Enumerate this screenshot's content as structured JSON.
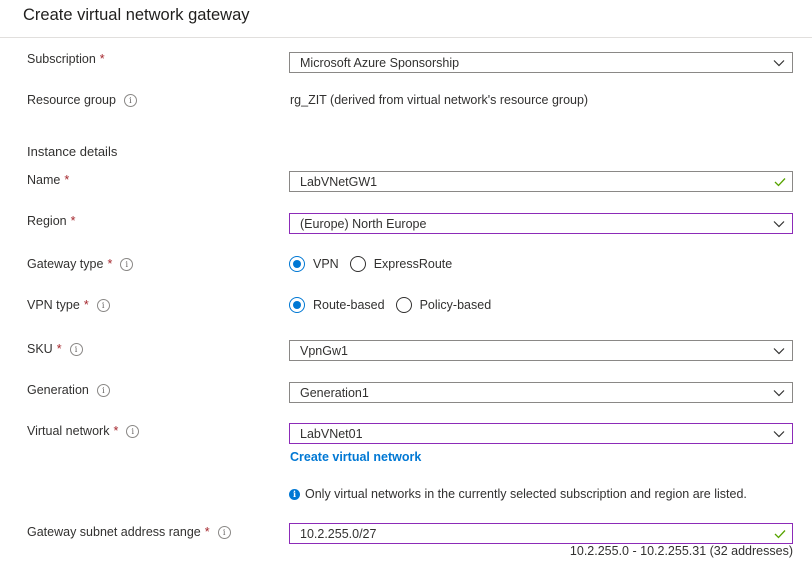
{
  "page": {
    "title": "Create virtual network gateway"
  },
  "subscription": {
    "label": "Subscription",
    "required_mark": "*",
    "value": "Microsoft Azure Sponsorship"
  },
  "resource_group": {
    "label": "Resource group",
    "value": "rg_ZIT (derived from virtual network's resource group)"
  },
  "instance_details": {
    "heading": "Instance details"
  },
  "name": {
    "label": "Name",
    "required_mark": "*",
    "value": "LabVNetGW1",
    "valid": true
  },
  "region": {
    "label": "Region",
    "required_mark": "*",
    "value": "(Europe) North Europe"
  },
  "gateway_type": {
    "label": "Gateway type",
    "required_mark": "*",
    "options": [
      {
        "label": "VPN",
        "selected": true
      },
      {
        "label": "ExpressRoute",
        "selected": false
      }
    ]
  },
  "vpn_type": {
    "label": "VPN type",
    "required_mark": "*",
    "options": [
      {
        "label": "Route-based",
        "selected": true
      },
      {
        "label": "Policy-based",
        "selected": false
      }
    ]
  },
  "sku": {
    "label": "SKU",
    "required_mark": "*",
    "value": "VpnGw1"
  },
  "generation": {
    "label": "Generation",
    "value": "Generation1"
  },
  "virtual_network": {
    "label": "Virtual network",
    "required_mark": "*",
    "value": "LabVNet01",
    "create_link": "Create virtual network",
    "note": "Only virtual networks in the currently selected subscription and region are listed."
  },
  "gateway_subnet": {
    "label": "Gateway subnet address range",
    "required_mark": "*",
    "value": "10.2.255.0/27",
    "valid": true,
    "range_hint": "10.2.255.0 - 10.2.255.31 (32 addresses)"
  },
  "icons": {
    "info": "info-circle-icon",
    "dropdown": "chevron-down-icon",
    "valid": "checkmark-icon",
    "note": "info-filled-icon"
  },
  "colors": {
    "accent": "#0078d4",
    "focus_border": "#8c2bb8",
    "valid": "#57a300",
    "required": "#a4262c"
  }
}
